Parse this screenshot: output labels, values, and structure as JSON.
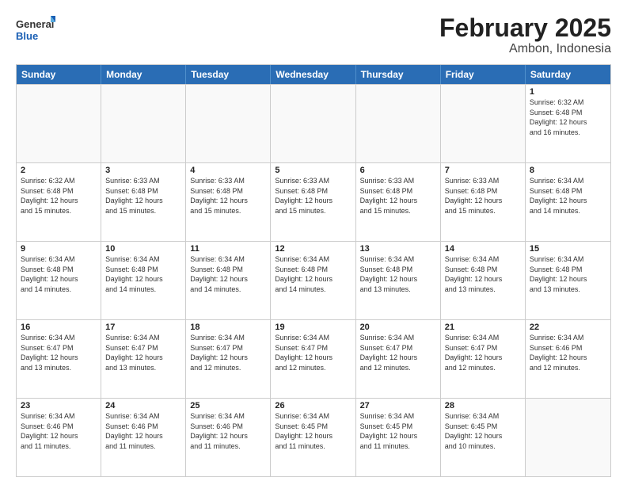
{
  "logo": {
    "general": "General",
    "blue": "Blue"
  },
  "title": {
    "main": "February 2025",
    "sub": "Ambon, Indonesia"
  },
  "calendar": {
    "headers": [
      "Sunday",
      "Monday",
      "Tuesday",
      "Wednesday",
      "Thursday",
      "Friday",
      "Saturday"
    ],
    "rows": [
      [
        {
          "day": "",
          "info": ""
        },
        {
          "day": "",
          "info": ""
        },
        {
          "day": "",
          "info": ""
        },
        {
          "day": "",
          "info": ""
        },
        {
          "day": "",
          "info": ""
        },
        {
          "day": "",
          "info": ""
        },
        {
          "day": "1",
          "info": "Sunrise: 6:32 AM\nSunset: 6:48 PM\nDaylight: 12 hours\nand 16 minutes."
        }
      ],
      [
        {
          "day": "2",
          "info": "Sunrise: 6:32 AM\nSunset: 6:48 PM\nDaylight: 12 hours\nand 15 minutes."
        },
        {
          "day": "3",
          "info": "Sunrise: 6:33 AM\nSunset: 6:48 PM\nDaylight: 12 hours\nand 15 minutes."
        },
        {
          "day": "4",
          "info": "Sunrise: 6:33 AM\nSunset: 6:48 PM\nDaylight: 12 hours\nand 15 minutes."
        },
        {
          "day": "5",
          "info": "Sunrise: 6:33 AM\nSunset: 6:48 PM\nDaylight: 12 hours\nand 15 minutes."
        },
        {
          "day": "6",
          "info": "Sunrise: 6:33 AM\nSunset: 6:48 PM\nDaylight: 12 hours\nand 15 minutes."
        },
        {
          "day": "7",
          "info": "Sunrise: 6:33 AM\nSunset: 6:48 PM\nDaylight: 12 hours\nand 15 minutes."
        },
        {
          "day": "8",
          "info": "Sunrise: 6:34 AM\nSunset: 6:48 PM\nDaylight: 12 hours\nand 14 minutes."
        }
      ],
      [
        {
          "day": "9",
          "info": "Sunrise: 6:34 AM\nSunset: 6:48 PM\nDaylight: 12 hours\nand 14 minutes."
        },
        {
          "day": "10",
          "info": "Sunrise: 6:34 AM\nSunset: 6:48 PM\nDaylight: 12 hours\nand 14 minutes."
        },
        {
          "day": "11",
          "info": "Sunrise: 6:34 AM\nSunset: 6:48 PM\nDaylight: 12 hours\nand 14 minutes."
        },
        {
          "day": "12",
          "info": "Sunrise: 6:34 AM\nSunset: 6:48 PM\nDaylight: 12 hours\nand 14 minutes."
        },
        {
          "day": "13",
          "info": "Sunrise: 6:34 AM\nSunset: 6:48 PM\nDaylight: 12 hours\nand 13 minutes."
        },
        {
          "day": "14",
          "info": "Sunrise: 6:34 AM\nSunset: 6:48 PM\nDaylight: 12 hours\nand 13 minutes."
        },
        {
          "day": "15",
          "info": "Sunrise: 6:34 AM\nSunset: 6:48 PM\nDaylight: 12 hours\nand 13 minutes."
        }
      ],
      [
        {
          "day": "16",
          "info": "Sunrise: 6:34 AM\nSunset: 6:47 PM\nDaylight: 12 hours\nand 13 minutes."
        },
        {
          "day": "17",
          "info": "Sunrise: 6:34 AM\nSunset: 6:47 PM\nDaylight: 12 hours\nand 13 minutes."
        },
        {
          "day": "18",
          "info": "Sunrise: 6:34 AM\nSunset: 6:47 PM\nDaylight: 12 hours\nand 12 minutes."
        },
        {
          "day": "19",
          "info": "Sunrise: 6:34 AM\nSunset: 6:47 PM\nDaylight: 12 hours\nand 12 minutes."
        },
        {
          "day": "20",
          "info": "Sunrise: 6:34 AM\nSunset: 6:47 PM\nDaylight: 12 hours\nand 12 minutes."
        },
        {
          "day": "21",
          "info": "Sunrise: 6:34 AM\nSunset: 6:47 PM\nDaylight: 12 hours\nand 12 minutes."
        },
        {
          "day": "22",
          "info": "Sunrise: 6:34 AM\nSunset: 6:46 PM\nDaylight: 12 hours\nand 12 minutes."
        }
      ],
      [
        {
          "day": "23",
          "info": "Sunrise: 6:34 AM\nSunset: 6:46 PM\nDaylight: 12 hours\nand 11 minutes."
        },
        {
          "day": "24",
          "info": "Sunrise: 6:34 AM\nSunset: 6:46 PM\nDaylight: 12 hours\nand 11 minutes."
        },
        {
          "day": "25",
          "info": "Sunrise: 6:34 AM\nSunset: 6:46 PM\nDaylight: 12 hours\nand 11 minutes."
        },
        {
          "day": "26",
          "info": "Sunrise: 6:34 AM\nSunset: 6:45 PM\nDaylight: 12 hours\nand 11 minutes."
        },
        {
          "day": "27",
          "info": "Sunrise: 6:34 AM\nSunset: 6:45 PM\nDaylight: 12 hours\nand 11 minutes."
        },
        {
          "day": "28",
          "info": "Sunrise: 6:34 AM\nSunset: 6:45 PM\nDaylight: 12 hours\nand 10 minutes."
        },
        {
          "day": "",
          "info": ""
        }
      ]
    ]
  }
}
